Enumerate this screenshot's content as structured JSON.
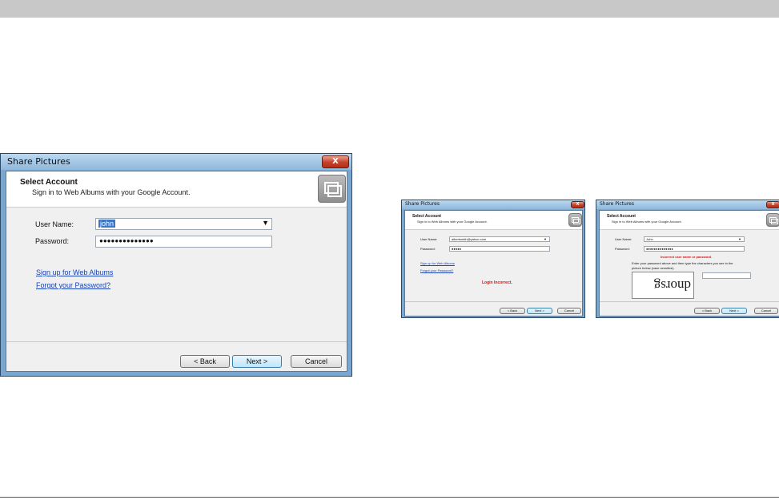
{
  "main_dialog": {
    "title": "Share Pictures",
    "close_label": "X",
    "header_title": "Select Account",
    "header_subtitle": "Sign in to Web Albums with your Google Account.",
    "user_name_label": "User Name:",
    "user_name_value": "john",
    "password_label": "Password:",
    "password_value": "●●●●●●●●●●●●●●",
    "signup_link": "Sign up for Web Albums",
    "forgot_link": "Forgot your Password?",
    "back_button": "< Back",
    "next_button": "Next >",
    "cancel_button": "Cancel"
  },
  "error_dialog_1": {
    "title": "Share Pictures",
    "close_label": "X",
    "header_title": "Select Account",
    "header_subtitle": "Sign in to Web Albums with your Google Account.",
    "user_name_label": "User Name:",
    "user_name_value": "albertsmith@yahoo.com",
    "password_label": "Password:",
    "password_value": "●●●●●",
    "signup_link": "Sign up for Web Albums",
    "forgot_link": "Forgot your Password?",
    "error_text": "Login Incorrect.",
    "back_button": "< Back",
    "next_button": "Next >",
    "cancel_button": "Cancel"
  },
  "error_dialog_2": {
    "title": "Share Pictures",
    "close_label": "X",
    "header_title": "Select Account",
    "header_subtitle": "Sign in to Web Albums with your Google Account.",
    "user_name_label": "User Name:",
    "user_name_value": "John",
    "password_label": "Password:",
    "password_value": "●●●●●●●●●●●●●●",
    "error_text": "Incorrect user name or password.",
    "captcha_instructions_1": "Enter your password above and then type the characters you see in the",
    "captcha_instructions_2": "picture below (case sensitive).",
    "captcha_text": "dnorsg",
    "back_button": "< Back",
    "next_button": "Next >",
    "cancel_button": "Cancel"
  }
}
